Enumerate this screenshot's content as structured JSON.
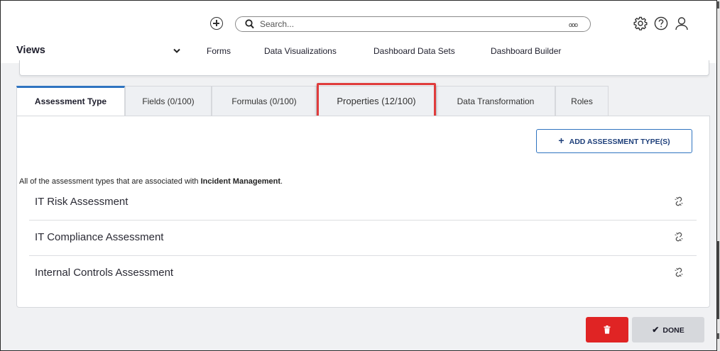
{
  "topbar": {
    "search_placeholder": "Search...",
    "search_more": "ooo",
    "icons": [
      "add-circle-icon",
      "search-icon",
      "settings-icon",
      "help-icon",
      "user-icon"
    ]
  },
  "nav": {
    "views_label": "Views",
    "items": [
      "Forms",
      "Data Visualizations",
      "Dashboard Data Sets",
      "Dashboard Builder"
    ],
    "active": "Dashboard Data Sets"
  },
  "tabs": [
    {
      "label": "Assessment Type"
    },
    {
      "label": "Fields (0/100)"
    },
    {
      "label": "Formulas (0/100)"
    },
    {
      "label": "Properties (12/100)"
    },
    {
      "label": "Data Transformation"
    },
    {
      "label": "Roles"
    }
  ],
  "active_tab": "Assessment Type",
  "highlighted_tab": "Properties (12/100)",
  "content": {
    "add_button_label": "ADD ASSESSMENT TYPE(S)",
    "description_prefix": "All of the assessment types that are associated with ",
    "description_bold": "Incident Management",
    "description_suffix": ".",
    "rows": [
      {
        "label": "IT Risk Assessment"
      },
      {
        "label": "IT Compliance Assessment"
      },
      {
        "label": "Internal Controls Assessment"
      }
    ]
  },
  "footer": {
    "done_label": "DONE"
  },
  "colors": {
    "accent": "#2f74c0",
    "highlight": "#e03c3c",
    "delete": "#e02424",
    "done_bg": "#d6d8dc"
  }
}
